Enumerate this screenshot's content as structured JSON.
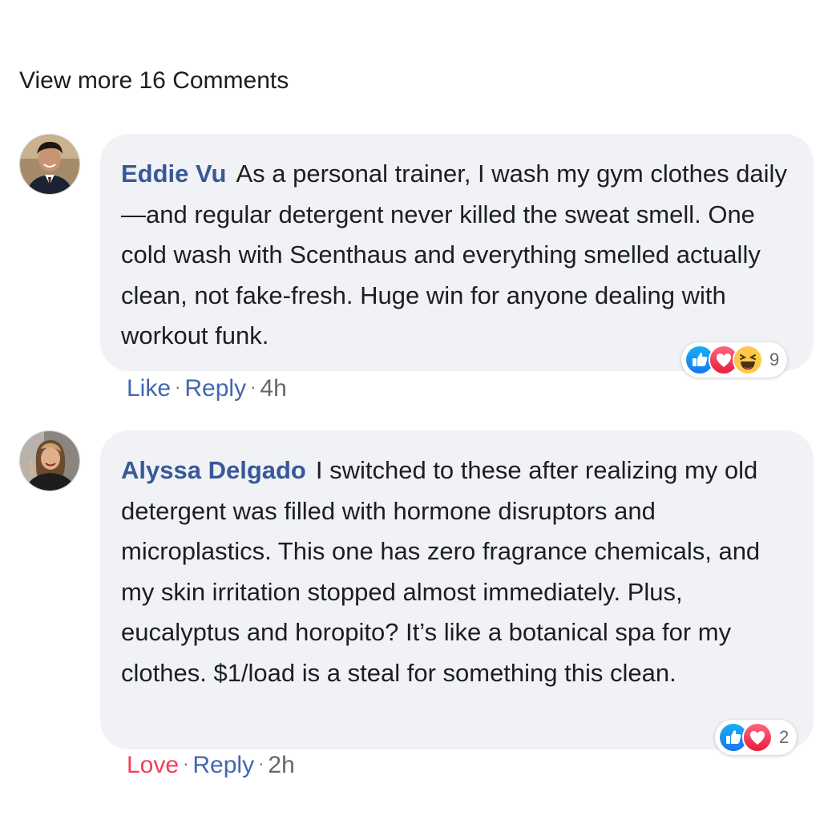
{
  "view_more": "View more 16 Comments",
  "comments": [
    {
      "author": "Eddie Vu",
      "text": "As a personal trainer, I wash my gym clothes daily—and regular detergent never killed the sweat smell. One cold wash with Scenthaus and everything smelled actually clean, not fake-fresh. Huge win for anyone dealing with workout funk.",
      "reaction_count": "9",
      "reactions": [
        "like-icon",
        "love-icon",
        "haha-icon"
      ],
      "action_primary": "Like",
      "action_reply": "Reply",
      "dot": "·",
      "time": "4h"
    },
    {
      "author": "Alyssa Delgado",
      "text": "I switched to these after realizing my old detergent was filled with hormone disruptors and microplastics. This one has zero fragrance chemicals, and my skin irritation stopped almost immediately. Plus, eucalyptus and horopito? It’s like a botanical spa for my clothes. $1/load is a steal for something this clean.",
      "reaction_count": "2",
      "reactions": [
        "like-icon",
        "love-icon"
      ],
      "action_primary": "Love",
      "action_reply": "Reply",
      "dot": "·",
      "time": "2h"
    }
  ],
  "colors": {
    "author": "#385898",
    "link": "#4267b2",
    "love": "#f33e58",
    "bubble": "#f0f2f5",
    "meta": "#65676b",
    "like_gradient_top": "#18aff2",
    "like_gradient_bottom": "#1877f2",
    "love_gradient_top": "#ff6680",
    "love_gradient_bottom": "#e61e3d",
    "haha": "#fcc94a"
  }
}
